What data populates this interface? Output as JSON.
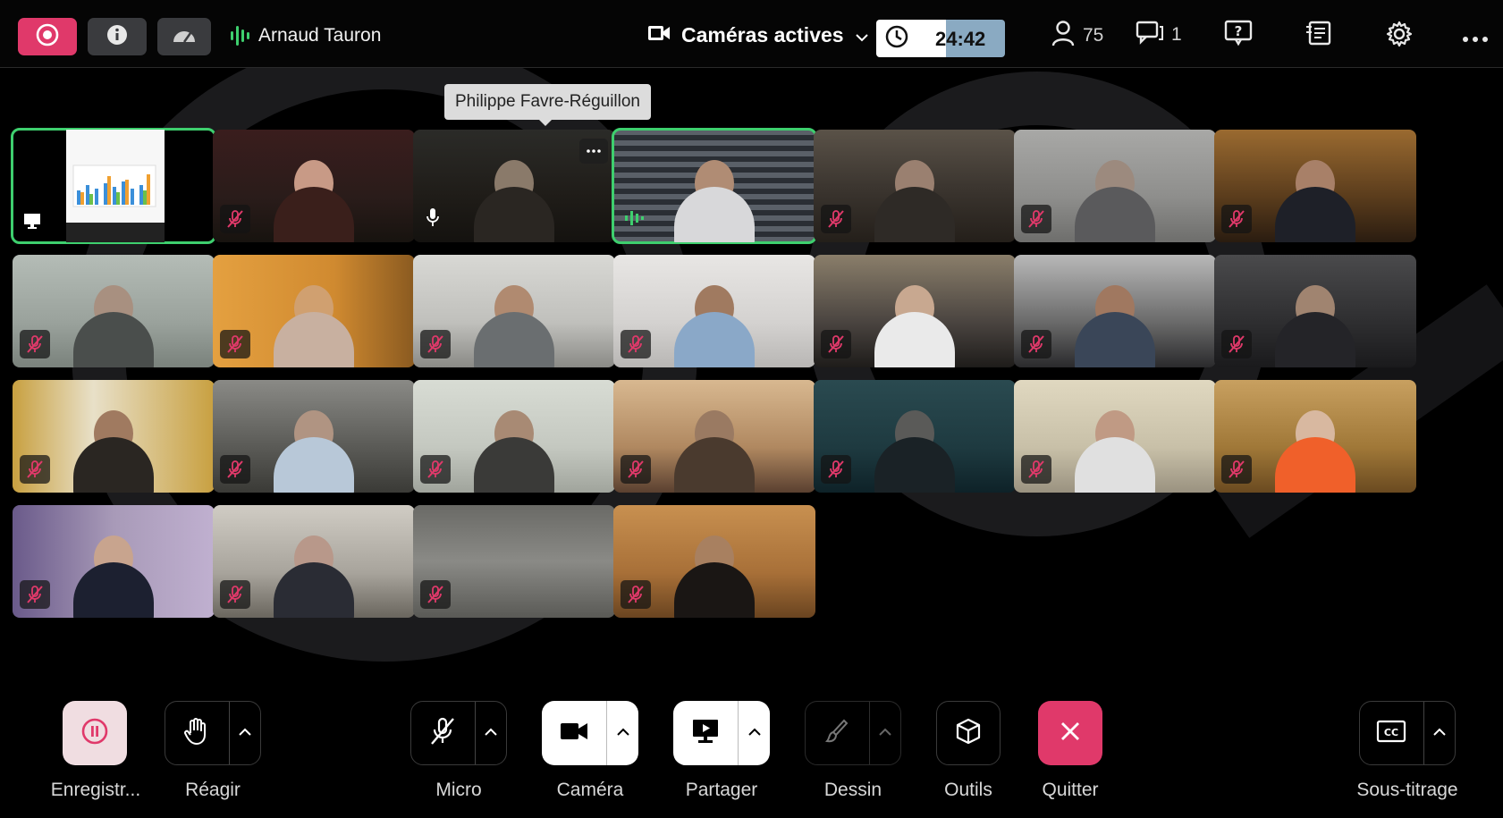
{
  "topbar": {
    "speaker_name": "Arnaud Tauron",
    "layout_label": "Caméras actives",
    "timer": "24:42",
    "participants_count": "75",
    "chat_count": "1"
  },
  "tooltip": "Philippe Favre-Réguillon",
  "toolbar": {
    "record_label": "Enregistr...",
    "react_label": "Réagir",
    "mic_label": "Micro",
    "camera_label": "Caméra",
    "share_label": "Partager",
    "draw_label": "Dessin",
    "tools_label": "Outils",
    "quit_label": "Quitter",
    "captions_label": "Sous-titrage"
  },
  "colors": {
    "accent_red": "#e0396a",
    "active_green": "#3ecf6e",
    "muted_icon": "#e0396a"
  }
}
